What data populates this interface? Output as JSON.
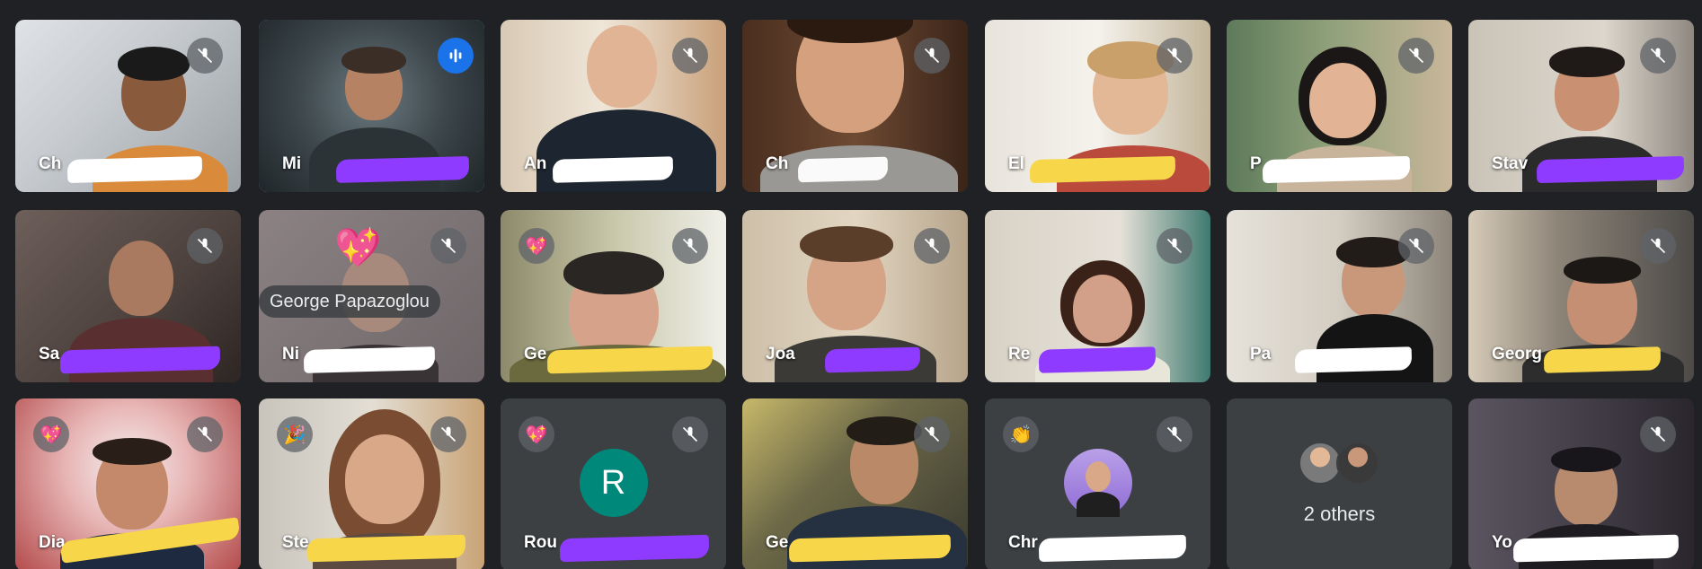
{
  "participants": [
    {
      "name": "Ch",
      "redacted": true,
      "redact_color": "#ffffff"
    },
    {
      "name": "Mi",
      "redacted": true,
      "redact_color": "#8f3bff"
    },
    {
      "name": "An",
      "redacted": true,
      "redact_color": "#ffffff"
    },
    {
      "name": "Ch",
      "redacted": true,
      "redact_color": "#ffffff"
    },
    {
      "name": "El",
      "redacted": true,
      "redact_color": "#f7d64a"
    },
    {
      "name": "P",
      "redacted": true,
      "redact_color": "#ffffff"
    },
    {
      "name": "Stav",
      "redacted": true,
      "redact_color": "#8f3bff"
    },
    {
      "name": "Sa",
      "redacted": true,
      "redact_color": "#8f3bff"
    },
    {
      "name": "Ni",
      "redacted": true,
      "redact_color": "#ffffff"
    },
    {
      "name": "Ge",
      "redacted": true,
      "redact_color": "#f7d64a"
    },
    {
      "name": "Joa",
      "redacted": true,
      "redact_color": "#8f3bff"
    },
    {
      "name": "Re",
      "redacted": true,
      "redact_color": "#8f3bff"
    },
    {
      "name": "Pa",
      "redacted": true,
      "redact_color": "#ffffff"
    },
    {
      "name": "Georg",
      "redacted": true,
      "redact_color": "#f7d64a"
    },
    {
      "name": "Dia",
      "redacted": true,
      "redact_color": "#f7d64a"
    },
    {
      "name": "Ste",
      "redacted": true,
      "redact_color": "#f7d64a"
    },
    {
      "name": "Rou",
      "redacted": true,
      "redact_color": "#8f3bff"
    },
    {
      "name": "Ge",
      "redacted": true,
      "redact_color": "#f7d64a"
    },
    {
      "name": "Chr",
      "redacted": true,
      "redact_color": "#ffffff"
    },
    {
      "name": "Yo",
      "redacted": true,
      "redact_color": "#ffffff"
    }
  ],
  "hover_tooltip": "George Papazoglou",
  "avatar_initial": "R",
  "avatar_color": "#00897b",
  "others_label": "2 others",
  "icons": {
    "mute": "mic-off-icon",
    "speaking": "audio-level-icon",
    "reaction_heart": "sparkling-heart-emoji",
    "reaction_party": "party-popper-emoji",
    "reaction_clap": "clapping-hands-emoji"
  },
  "reactions": {
    "heart": "💖",
    "sparkle": "💖",
    "party": "🎉",
    "clap": "👏"
  },
  "colors": {
    "background": "#202124",
    "tile": "#3c4043",
    "active_outline": "#8ab4f8",
    "speaking": "#1a73e8"
  }
}
